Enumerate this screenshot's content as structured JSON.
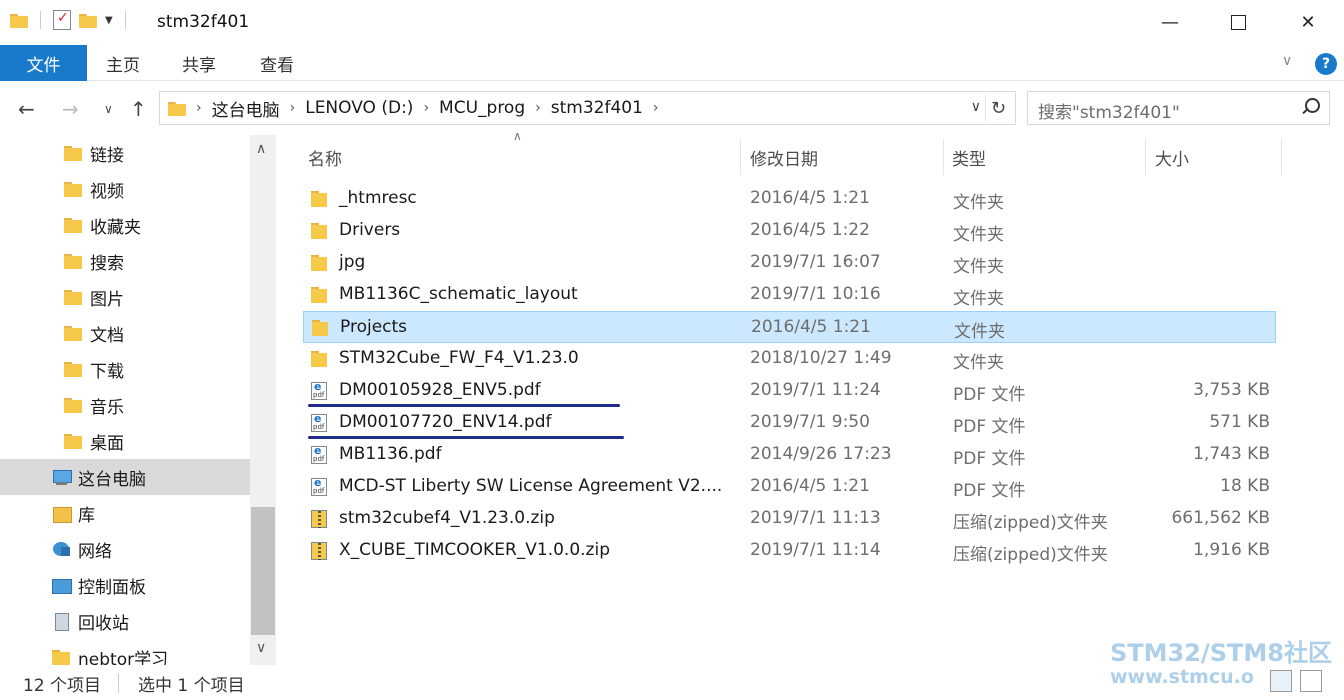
{
  "window": {
    "title": "stm32f401",
    "minimize": "—",
    "close": "✕"
  },
  "ribbon": {
    "tabs": [
      "文件",
      "主页",
      "共享",
      "查看"
    ],
    "help": "?"
  },
  "nav": {
    "back": "←",
    "forward": "→",
    "recent": "∨",
    "up": "↑",
    "breadcrumb": [
      "这台电脑",
      "LENOVO (D:)",
      "MCU_prog",
      "stm32f401"
    ],
    "search_placeholder": "搜索\"stm32f401\""
  },
  "sidebar": {
    "items": [
      {
        "label": "链接",
        "icon": "folder-link-icon"
      },
      {
        "label": "视频",
        "icon": "folder-video-icon"
      },
      {
        "label": "收藏夹",
        "icon": "folder-favorites-icon"
      },
      {
        "label": "搜索",
        "icon": "folder-search-icon"
      },
      {
        "label": "图片",
        "icon": "folder-pictures-icon"
      },
      {
        "label": "文档",
        "icon": "folder-documents-icon"
      },
      {
        "label": "下载",
        "icon": "folder-downloads-icon"
      },
      {
        "label": "音乐",
        "icon": "folder-music-icon"
      },
      {
        "label": "桌面",
        "icon": "folder-desktop-icon"
      },
      {
        "label": "这台电脑",
        "icon": "this-pc-icon",
        "selected": true
      },
      {
        "label": "库",
        "icon": "libraries-icon"
      },
      {
        "label": "网络",
        "icon": "network-icon"
      },
      {
        "label": "控制面板",
        "icon": "control-panel-icon"
      },
      {
        "label": "回收站",
        "icon": "recycle-bin-icon"
      },
      {
        "label": "nebtor学习",
        "icon": "folder-icon"
      }
    ]
  },
  "filelist": {
    "columns": {
      "name": "名称",
      "date": "修改日期",
      "type": "类型",
      "size": "大小"
    },
    "rows": [
      {
        "name": "_htmresc",
        "date": "2016/4/5 1:21",
        "type": "文件夹",
        "size": "",
        "icon": "folder-icon"
      },
      {
        "name": "Drivers",
        "date": "2016/4/5 1:22",
        "type": "文件夹",
        "size": "",
        "icon": "folder-icon"
      },
      {
        "name": "jpg",
        "date": "2019/7/1 16:07",
        "type": "文件夹",
        "size": "",
        "icon": "folder-icon"
      },
      {
        "name": "MB1136C_schematic_layout",
        "date": "2019/7/1 10:16",
        "type": "文件夹",
        "size": "",
        "icon": "folder-icon"
      },
      {
        "name": "Projects",
        "date": "2016/4/5 1:21",
        "type": "文件夹",
        "size": "",
        "icon": "folder-icon",
        "selected": true
      },
      {
        "name": "STM32Cube_FW_F4_V1.23.0",
        "date": "2018/10/27 1:49",
        "type": "文件夹",
        "size": "",
        "icon": "folder-icon"
      },
      {
        "name": "DM00105928_ENV5.pdf",
        "date": "2019/7/1 11:24",
        "type": "PDF 文件",
        "size": "3,753 KB",
        "icon": "pdf-icon",
        "underlined": true
      },
      {
        "name": "DM00107720_ENV14.pdf",
        "date": "2019/7/1 9:50",
        "type": "PDF 文件",
        "size": "571 KB",
        "icon": "pdf-icon",
        "underlined": true
      },
      {
        "name": "MB1136.pdf",
        "date": "2014/9/26 17:23",
        "type": "PDF 文件",
        "size": "1,743 KB",
        "icon": "pdf-icon"
      },
      {
        "name": "MCD-ST Liberty SW License Agreement V2....",
        "date": "2016/4/5 1:21",
        "type": "PDF 文件",
        "size": "18 KB",
        "icon": "pdf-icon"
      },
      {
        "name": "stm32cubef4_V1.23.0.zip",
        "date": "2019/7/1 11:13",
        "type": "压缩(zipped)文件夹",
        "size": "661,562 KB",
        "icon": "zip-icon"
      },
      {
        "name": "X_CUBE_TIMCOOKER_V1.0.0.zip",
        "date": "2019/7/1 11:14",
        "type": "压缩(zipped)文件夹",
        "size": "1,916 KB",
        "icon": "zip-icon"
      }
    ]
  },
  "status": {
    "count": "12 个项目",
    "selection": "选中 1 个项目"
  },
  "watermark": {
    "line1": "STM32/STM8社区",
    "line2": "www.stmcu.o"
  }
}
